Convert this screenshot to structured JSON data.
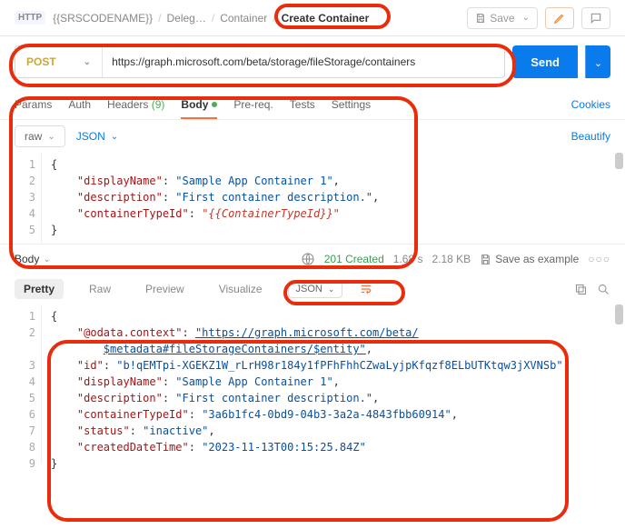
{
  "header": {
    "http_badge": "HTTP",
    "crumb1": "{{SRSCODENAME}}",
    "crumb2": "Deleg…",
    "crumb3": "Container",
    "crumb4": "Create Container",
    "save": "Save"
  },
  "request": {
    "method": "POST",
    "url": "https://graph.microsoft.com/beta/storage/fileStorage/containers",
    "send": "Send"
  },
  "tabs": {
    "params": "Params",
    "auth": "Auth",
    "headers": "Headers",
    "headers_count": "(9)",
    "body": "Body",
    "prereq": "Pre-req.",
    "tests": "Tests",
    "settings": "Settings",
    "cookies": "Cookies"
  },
  "body_opts": {
    "raw": "raw",
    "json": "JSON",
    "beautify": "Beautify"
  },
  "req_body_lines": [
    {
      "n": "1",
      "text": "{"
    },
    {
      "n": "2",
      "k": "\"displayName\"",
      "v": "\"Sample App Container 1\"",
      "suf": ","
    },
    {
      "n": "3",
      "k": "\"description\"",
      "v": "\"First container description.\"",
      "suf": ","
    },
    {
      "n": "4",
      "k": "\"containerTypeId\"",
      "v": "\"{{ContainerTypeId}}\"",
      "var": true
    },
    {
      "n": "5",
      "text": "}"
    }
  ],
  "response": {
    "body_label": "Body",
    "status": "201 Created",
    "time": "1.68 s",
    "size": "2.18 KB",
    "save_example": "Save as example"
  },
  "resp_tabs": {
    "pretty": "Pretty",
    "raw": "Raw",
    "preview": "Preview",
    "visualize": "Visualize",
    "json": "JSON"
  },
  "resp_body_lines": [
    {
      "n": "1",
      "text": "{"
    },
    {
      "n": "2",
      "k": "\"@odata.context\"",
      "url1": "\"https://graph.microsoft.com/beta/",
      "url2": "$metadata#fileStorageContainers/$entity\"",
      "suf": ","
    },
    {
      "n": "3",
      "k": "\"id\"",
      "v": "\"b!qEMTpi-XGEKZ1W_rLrH98r184y1fPFhFhhCZwaLyjpKfqzf8ELbUTKtqw3jXVNSb\"",
      "suf": ","
    },
    {
      "n": "4",
      "k": "\"displayName\"",
      "v": "\"Sample App Container 1\"",
      "suf": ","
    },
    {
      "n": "5",
      "k": "\"description\"",
      "v": "\"First container description.\"",
      "suf": ","
    },
    {
      "n": "6",
      "k": "\"containerTypeId\"",
      "v": "\"3a6b1fc4-0bd9-04b3-3a2a-4843fbb60914\"",
      "suf": ","
    },
    {
      "n": "7",
      "k": "\"status\"",
      "v": "\"inactive\"",
      "suf": ","
    },
    {
      "n": "8",
      "k": "\"createdDateTime\"",
      "v": "\"2023-11-13T00:15:25.84Z\""
    },
    {
      "n": "9",
      "text": "}"
    }
  ]
}
